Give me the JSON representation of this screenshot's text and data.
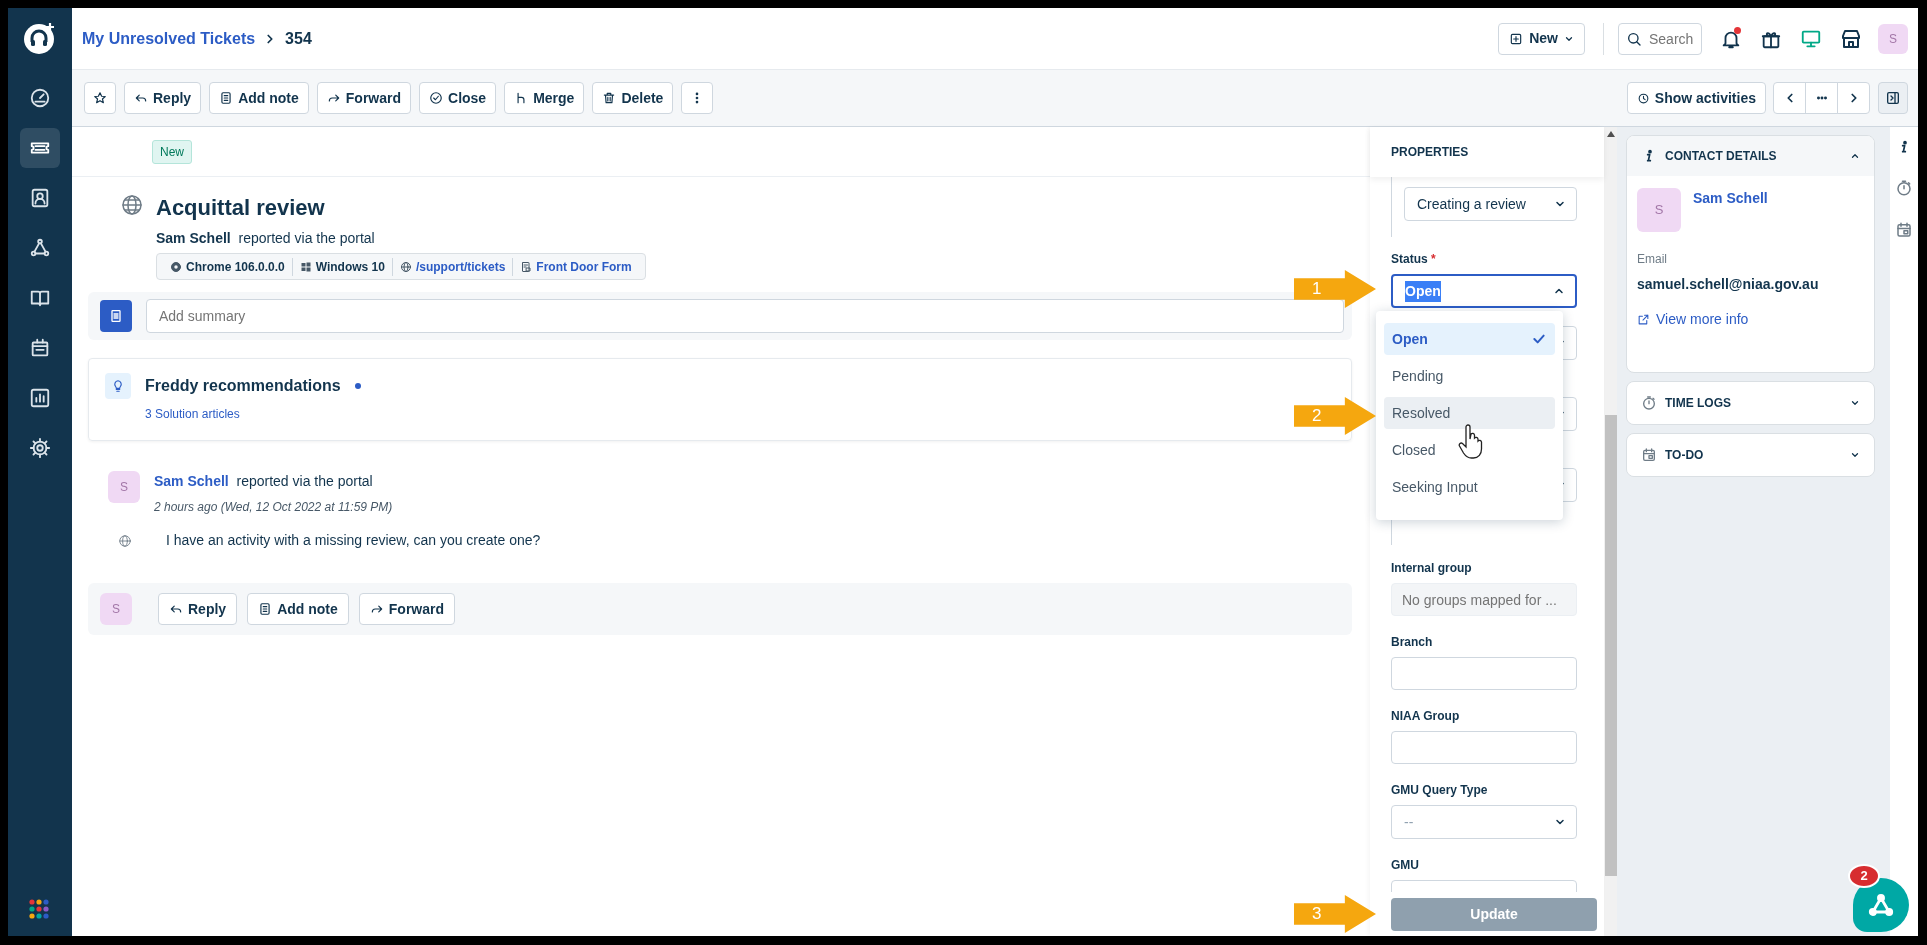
{
  "sidebar": {
    "items": [
      {
        "kind": "dashboard",
        "selected": false
      },
      {
        "kind": "tickets",
        "selected": true
      },
      {
        "kind": "contacts",
        "selected": false
      },
      {
        "kind": "groups",
        "selected": false
      },
      {
        "kind": "solutions",
        "selected": false
      },
      {
        "kind": "assets",
        "selected": false
      },
      {
        "kind": "reports",
        "selected": false
      },
      {
        "kind": "admin",
        "selected": false
      }
    ]
  },
  "breadcrumb": {
    "parent": "My Unresolved Tickets",
    "current": "354"
  },
  "header_actions": {
    "new_button": "New",
    "search_placeholder": "Search",
    "notifications_unread": true,
    "avatar": "S"
  },
  "toolbar": {
    "buttons": [
      {
        "kind": "star"
      },
      {
        "kind": "reply",
        "label": "Reply"
      },
      {
        "kind": "note",
        "label": "Add note"
      },
      {
        "kind": "forward",
        "label": "Forward"
      },
      {
        "kind": "close",
        "label": "Close"
      },
      {
        "kind": "merge",
        "label": "Merge"
      },
      {
        "kind": "delete",
        "label": "Delete"
      },
      {
        "kind": "more"
      }
    ],
    "show_activities": "Show activities"
  },
  "ticket": {
    "status_tag": "New",
    "title": "Acquittal review",
    "requester": "Sam Schell",
    "source_text": "reported via the portal",
    "meta": [
      {
        "kind": "browser",
        "text": "Chrome 106.0.0.0",
        "link": false
      },
      {
        "kind": "os",
        "text": "Windows 10",
        "link": false
      },
      {
        "kind": "url",
        "text": "/support/tickets",
        "link": true
      },
      {
        "kind": "form",
        "text": "Front Door Form",
        "link": true
      }
    ],
    "summary_placeholder": "Add summary"
  },
  "freddy": {
    "title": "Freddy recommendations",
    "unread": true,
    "link": "3 Solution articles"
  },
  "conversation": [
    {
      "avatar": "S",
      "author": "Sam Schell",
      "source_text": "reported via the portal",
      "time": "2 hours ago (Wed, 12 Oct 2022 at 11:59 PM)",
      "body": "I have an activity with a missing review, can you create one?"
    }
  ],
  "reply_bar": {
    "avatar": "S",
    "buttons": [
      {
        "kind": "reply",
        "label": "Reply"
      },
      {
        "kind": "note",
        "label": "Add note"
      },
      {
        "kind": "forward",
        "label": "Forward"
      }
    ]
  },
  "properties": {
    "title": "PROPERTIES",
    "category_value": "Creating a review",
    "status": {
      "label": "Status",
      "required_mark": "*",
      "value": "Open",
      "text_selected": true,
      "expanded": true,
      "options": [
        {
          "label": "Open",
          "selected": true,
          "hovered": false
        },
        {
          "label": "Pending",
          "selected": false,
          "hovered": false
        },
        {
          "label": "Resolved",
          "selected": false,
          "hovered": true
        },
        {
          "label": "Closed",
          "selected": false,
          "hovered": false
        },
        {
          "label": "Seeking Input",
          "selected": false,
          "hovered": false
        }
      ]
    },
    "covered_fields": [
      {
        "kind": "select"
      },
      {
        "kind": "select"
      },
      {
        "kind": "select"
      }
    ],
    "fields": [
      {
        "kind": "disabled",
        "label": "Internal group",
        "placeholder": "No groups mapped for ..."
      },
      {
        "kind": "text",
        "label": "Branch"
      },
      {
        "kind": "text",
        "label": "NIAA Group"
      },
      {
        "kind": "select",
        "label": "GMU Query Type",
        "value": "--"
      },
      {
        "kind": "text",
        "label": "GMU"
      }
    ],
    "update_button": {
      "label": "Update",
      "disabled": true
    }
  },
  "contact_details": {
    "title": "CONTACT DETAILS",
    "expanded": true,
    "avatar": "S",
    "name": "Sam Schell",
    "email_label": "Email",
    "email": "samuel.schell@niaa.gov.au",
    "link": "View more info"
  },
  "side_cards": [
    {
      "kind": "time_logs",
      "title": "TIME LOGS",
      "expanded": false
    },
    {
      "kind": "todo",
      "title": "TO-DO",
      "expanded": false
    }
  ],
  "assistant": {
    "badge": "2"
  },
  "annotations": [
    {
      "label": "1"
    },
    {
      "label": "2"
    },
    {
      "label": "3"
    }
  ]
}
